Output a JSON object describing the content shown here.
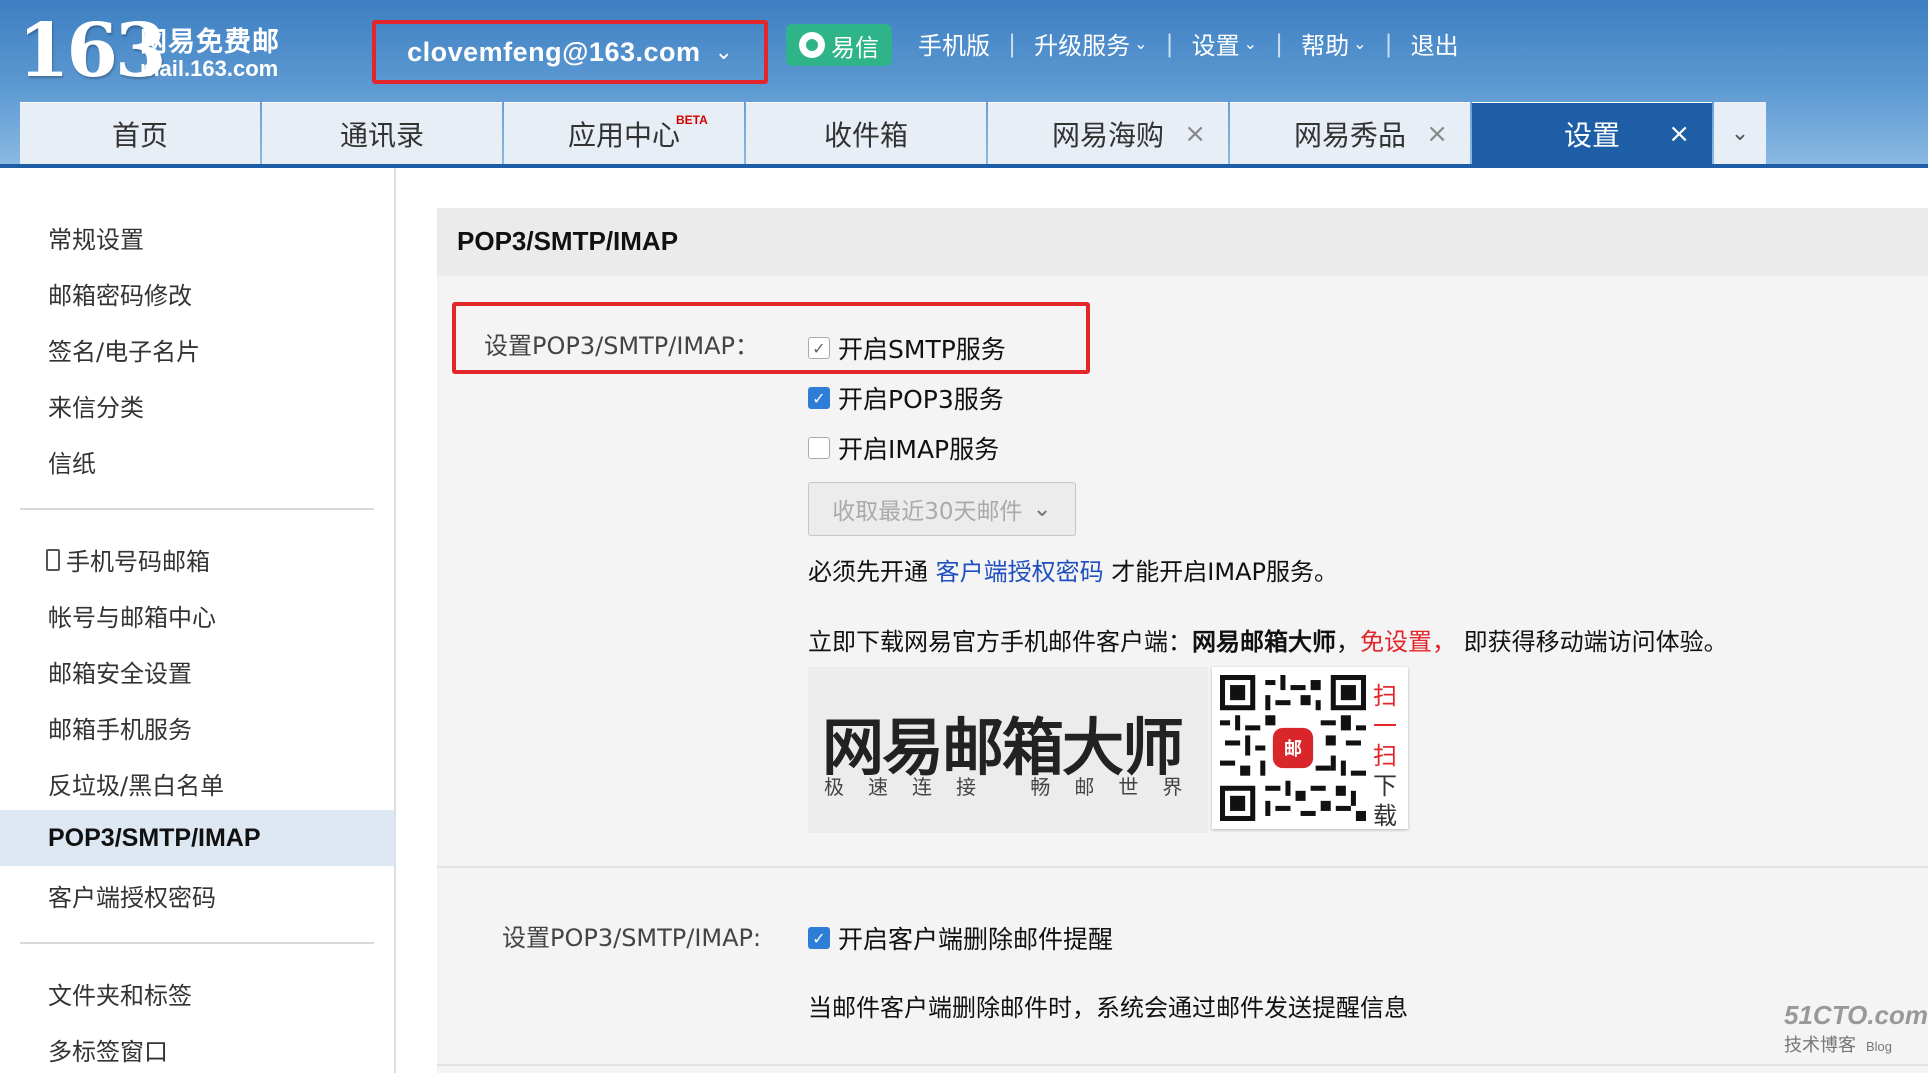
{
  "header": {
    "logo_num": "163",
    "logo_cn": "网易免费邮",
    "logo_domain": "mail.163.com",
    "account": "clovemfeng@163.com",
    "yixin": "易信",
    "nav": [
      {
        "label": "手机版"
      },
      {
        "label": "升级服务"
      },
      {
        "label": "设置"
      },
      {
        "label": "帮助"
      },
      {
        "label": "退出"
      }
    ]
  },
  "tabs": [
    {
      "label": "首页"
    },
    {
      "label": "通讯录"
    },
    {
      "label": "应用中心",
      "badge": "BETA"
    },
    {
      "label": "收件箱"
    },
    {
      "label": "网易海购"
    },
    {
      "label": "网易秀品"
    },
    {
      "label": "设置"
    }
  ],
  "sidebar": {
    "group1": [
      "常规设置",
      "邮箱密码修改",
      "签名/电子名片",
      "来信分类",
      "信纸"
    ],
    "group2": [
      "手机号码邮箱",
      "帐号与邮箱中心",
      "邮箱安全设置",
      "邮箱手机服务",
      "反垃圾/黑白名单",
      "POP3/SMTP/IMAP",
      "客户端授权密码"
    ],
    "group3": [
      "文件夹和标签",
      "多标签窗口"
    ]
  },
  "main": {
    "title": "POP3/SMTP/IMAP",
    "section1_label": "设置POP3/SMTP/IMAP：",
    "checkboxes": [
      {
        "label": "开启SMTP服务",
        "checked": true
      },
      {
        "label": "开启POP3服务",
        "checked": true
      },
      {
        "label": "开启IMAP服务",
        "checked": false
      }
    ],
    "select_value": "收取最近30天邮件",
    "note1_pre": "必须先开通",
    "note1_link": "客户端授权密码",
    "note1_post": "才能开启IMAP服务。",
    "note2_pre": "立即下载网易官方手机邮件客户端：",
    "note2_bold": "网易邮箱大师",
    "note2_comma": "，",
    "note2_red": "免设置，",
    "note2_post": "即获得移动端访问体验。",
    "promo_title": "网易邮箱大师",
    "promo_sub": "极速连接 畅邮世界",
    "qr_side1": "扫",
    "qr_side2": "一",
    "qr_side3": "扫",
    "qr_side4": "下",
    "qr_side5": "载",
    "qr_center": "邮",
    "section2_label": "设置POP3/SMTP/IMAP:",
    "section2_checkbox": "开启客户端删除邮件提醒",
    "section2_note": "当邮件客户端删除邮件时，系统会通过邮件发送提醒信息"
  },
  "watermark": {
    "site": "51CTO.com",
    "sub": "技术博客",
    "blog": "Blog"
  }
}
